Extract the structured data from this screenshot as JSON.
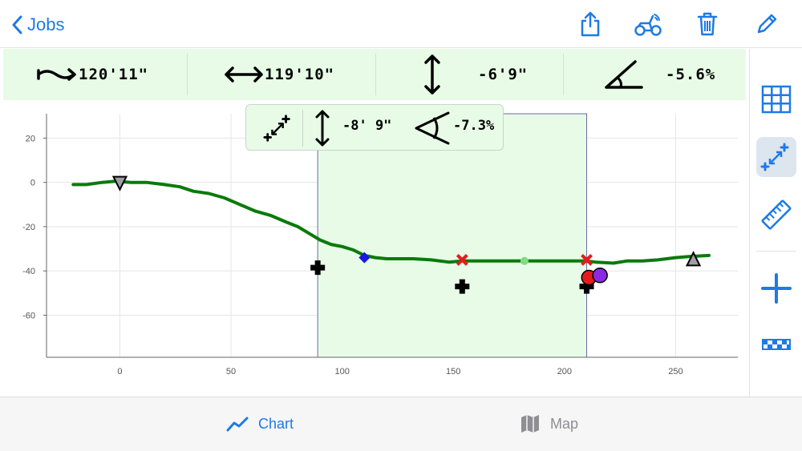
{
  "nav": {
    "back_label": "Jobs",
    "icons": [
      "share-icon",
      "tractor-icon",
      "trash-icon",
      "pencil-icon"
    ],
    "accent_color": "#1e7ae6"
  },
  "measurements": {
    "path_length": "120'11\"",
    "horizontal_distance": "119'10\"",
    "vertical_change": "-6'9\"",
    "slope": "-5.6%"
  },
  "selection_panel": {
    "vertical": "-8' 9\"",
    "angle": "-7.3%"
  },
  "right_toolbar": {
    "tools": [
      "grid-icon",
      "measure-icon",
      "ruler-icon",
      "add-icon",
      "dashed-line-icon"
    ],
    "active_tool": "measure-icon"
  },
  "chart_data": {
    "type": "line",
    "xlim": [
      -33,
      278
    ],
    "ylim": [
      -79,
      31
    ],
    "x_ticks": [
      0,
      50,
      100,
      150,
      200,
      250
    ],
    "y_ticks": [
      20,
      0,
      -20,
      -40,
      -60
    ],
    "grid": true,
    "series": [
      {
        "color": "#0a7a0a",
        "points": [
          [
            -21,
            -1
          ],
          [
            -15,
            -1
          ],
          [
            -8,
            0
          ],
          [
            -2,
            0.5
          ],
          [
            5,
            0
          ],
          [
            12,
            0
          ],
          [
            20,
            -1
          ],
          [
            27,
            -2
          ],
          [
            33,
            -4
          ],
          [
            40,
            -5
          ],
          [
            47,
            -7
          ],
          [
            54,
            -10
          ],
          [
            61,
            -13
          ],
          [
            68,
            -15
          ],
          [
            75,
            -18
          ],
          [
            80,
            -20
          ],
          [
            85,
            -23
          ],
          [
            90,
            -26
          ],
          [
            95,
            -28
          ],
          [
            100,
            -29
          ],
          [
            105,
            -30.5
          ],
          [
            110,
            -33
          ],
          [
            115,
            -34
          ],
          [
            120,
            -34.5
          ],
          [
            125,
            -34.5
          ],
          [
            132,
            -34.5
          ],
          [
            140,
            -35
          ],
          [
            148,
            -36
          ],
          [
            154,
            -35.5
          ],
          [
            210,
            -35.5
          ],
          [
            214,
            -36
          ],
          [
            222,
            -36.5
          ],
          [
            228,
            -35.5
          ],
          [
            235,
            -35.5
          ],
          [
            242,
            -35
          ],
          [
            250,
            -34
          ],
          [
            256,
            -33.5
          ],
          [
            265,
            -33
          ]
        ]
      }
    ],
    "selection_range": [
      89,
      210
    ],
    "selection_gap": {
      "x": [
        154,
        210
      ],
      "y": -35.5,
      "midpoint_x": 182
    },
    "markers": [
      {
        "kind": "triangle-down",
        "color": "#a0a0a0",
        "x": 0,
        "y": 0
      },
      {
        "kind": "triangle-up",
        "color": "#a0a0a0",
        "x": 258,
        "y": -35
      },
      {
        "kind": "cross",
        "color": "#000000",
        "x": 89,
        "y": -38.5
      },
      {
        "kind": "cross",
        "color": "#000000",
        "x": 154,
        "y": -47
      },
      {
        "kind": "cross",
        "color": "#000000",
        "x": 210,
        "y": -47
      },
      {
        "kind": "diamond",
        "color": "#1a1adf",
        "x": 110,
        "y": -34
      },
      {
        "kind": "x",
        "color": "#e61b1b",
        "x": 154,
        "y": -35
      },
      {
        "kind": "x",
        "color": "#e61b1b",
        "x": 210,
        "y": -35
      },
      {
        "kind": "dot",
        "color": "#e61b1b",
        "x": 211,
        "y": -43
      },
      {
        "kind": "dot",
        "color": "#8a2be2",
        "x": 216,
        "y": -42
      }
    ]
  },
  "tabs": [
    {
      "label": "Chart",
      "active": true
    },
    {
      "label": "Map",
      "active": false
    }
  ]
}
